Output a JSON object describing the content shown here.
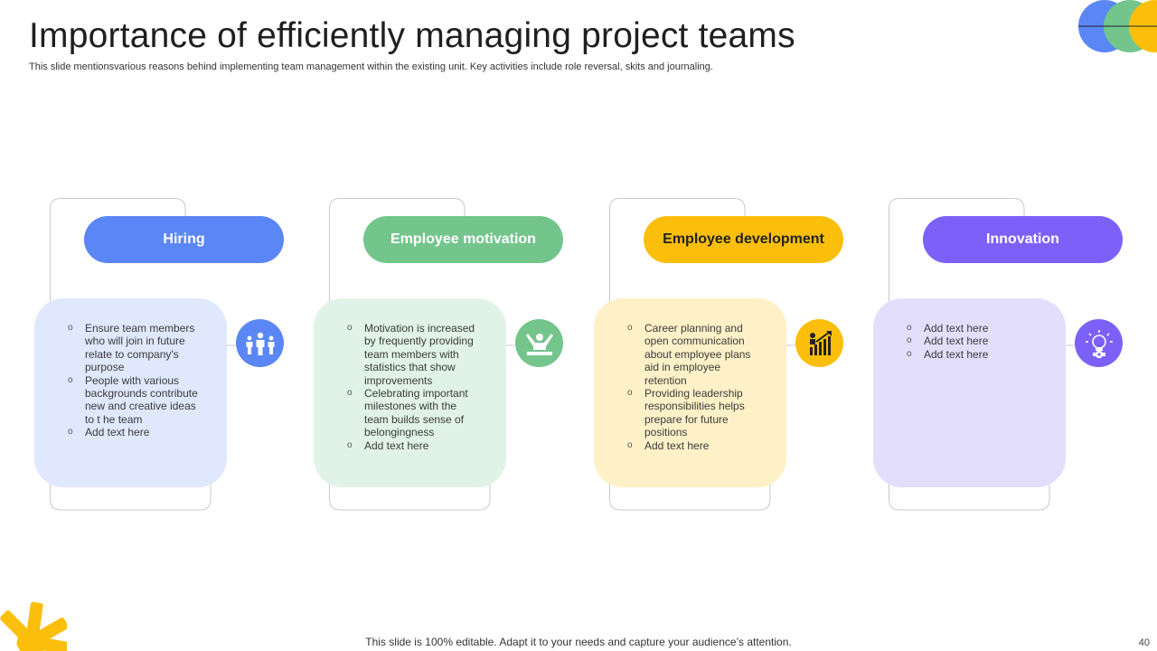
{
  "title": "Importance of efficiently managing project teams",
  "subtitle": "This slide mentionsvarious reasons behind implementing team management within the existing unit. Key activities include role reversal, skits and journaling.",
  "footer": "This slide is 100% editable. Adapt it to your needs and capture your audience’s attention.",
  "page_number": "40",
  "colors": {
    "blue": "#5b86f5",
    "green": "#73c58c",
    "yellow": "#fbbf0b",
    "purple": "#7b61f8"
  },
  "cards": [
    {
      "heading": "Hiring",
      "icon": "team-people-icon",
      "bullets": [
        "Ensure team members who will join in future relate to company's purpose",
        "People with various backgrounds contribute new and creative ideas to t he team",
        "Add text here"
      ]
    },
    {
      "heading": "Employee motivation",
      "icon": "motivated-person-icon",
      "bullets": [
        "Motivation is increased by frequently providing team members with statistics that show improvements",
        "Celebrating important milestones with the team builds sense of belongingness",
        "Add text here"
      ]
    },
    {
      "heading": "Employee development",
      "icon": "growth-chart-icon",
      "bullets": [
        "Career planning and open communication about employee plans aid in employee retention",
        "Providing leadership responsibilities helps prepare for future positions",
        "Add text here"
      ]
    },
    {
      "heading": "Innovation",
      "icon": "lightbulb-gear-icon",
      "bullets": [
        "Add text here",
        "Add text here",
        "Add text here"
      ]
    }
  ]
}
